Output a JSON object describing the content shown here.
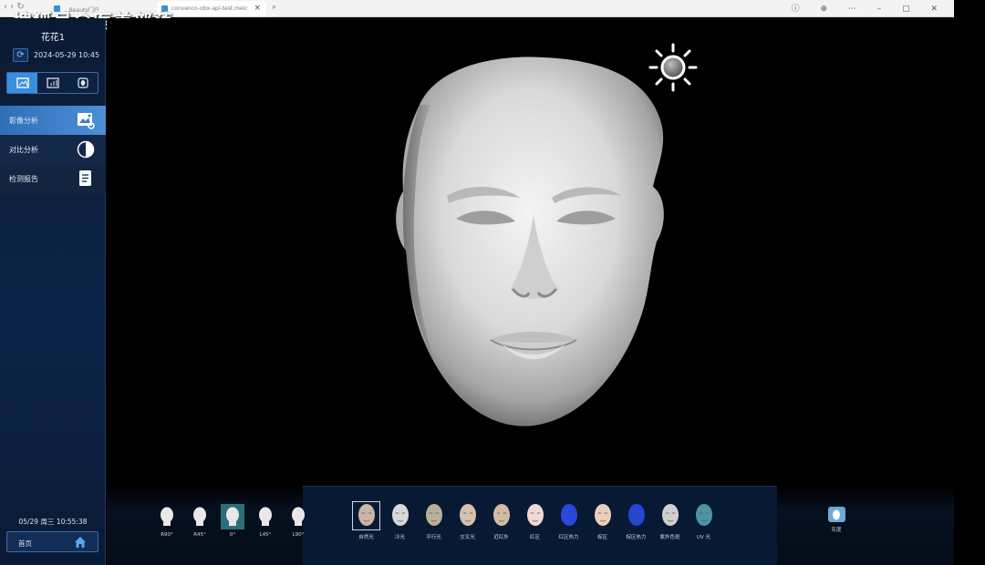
{
  "watermark": "搜狐号@医美部落",
  "browser": {
    "nav": "‹  ›  ↻",
    "tabs": [
      {
        "label": "...Beauty门户"
      },
      {
        "label": "convenco-obx-api-test.meic"
      }
    ],
    "window_icons": "ⓘ ⊕ ⋯ – ▢ ✕"
  },
  "sidebar": {
    "patient_name": "花花1",
    "datetime": "2024-05-29 10:45",
    "modes": [
      "image-mode",
      "chart-mode",
      "portrait-mode"
    ],
    "menu": [
      {
        "label": "影像分析",
        "icon": "image-analysis-icon",
        "active": true
      },
      {
        "label": "对比分析",
        "icon": "contrast-icon",
        "active": false
      },
      {
        "label": "检测报告",
        "icon": "report-icon",
        "active": false
      }
    ],
    "clock": "05/29 周三 10:55:38",
    "home_label": "首页"
  },
  "angles": [
    {
      "label": "R90°",
      "active": false
    },
    {
      "label": "R45°",
      "active": false
    },
    {
      "label": "0°",
      "active": true
    },
    {
      "label": "L45°",
      "active": false
    },
    {
      "label": "L90°",
      "active": false
    }
  ],
  "lights": [
    {
      "label": "自然光",
      "tone": "#c9b6a4",
      "active": true
    },
    {
      "label": "冷光",
      "tone": "#d8d8d8",
      "active": false
    },
    {
      "label": "平行光",
      "tone": "#b8b09a",
      "active": false
    },
    {
      "label": "交叉光",
      "tone": "#d6c1ad",
      "active": false
    },
    {
      "label": "近红外",
      "tone": "#d3bca4",
      "active": false
    },
    {
      "label": "红区",
      "tone": "#f1d8d4",
      "active": false
    },
    {
      "label": "红区热力",
      "tone": "#2748e0",
      "active": false
    },
    {
      "label": "棕区",
      "tone": "#e9d0b6",
      "active": false
    },
    {
      "label": "棕区热力",
      "tone": "#2346d6",
      "active": false
    },
    {
      "label": "紫外色斑",
      "tone": "#d0d0d0",
      "active": false
    },
    {
      "label": "UV 光",
      "tone": "#4f93a6",
      "active": false
    }
  ],
  "gray_label": "灰度",
  "colors": {
    "accent": "#3a8ede",
    "sidebar": "#0e2447"
  }
}
